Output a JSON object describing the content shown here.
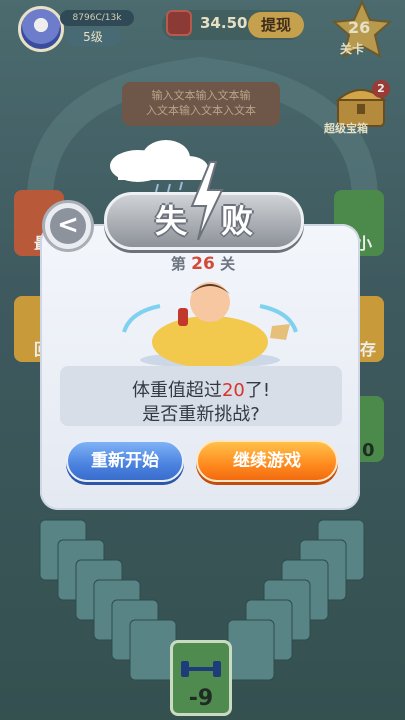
{
  "player": {
    "progress_text": "8796C/13k",
    "level": "5级"
  },
  "cash": {
    "value": "34.50",
    "withdraw_label": "提现"
  },
  "stage": {
    "number": "26",
    "label": "关卡"
  },
  "tutorial": {
    "line1": "输入文本输入文本输",
    "line2": "入文本输入文本入文本"
  },
  "treasure": {
    "label": "超级宝箱",
    "count": "2"
  },
  "side_labels": {
    "left_top": "最",
    "left_mid": "回",
    "right_top": "小",
    "right_mid": "存",
    "right_low": "0"
  },
  "modal": {
    "title": "失败",
    "stage_prefix": "第",
    "stage_num": "26",
    "stage_suffix": "关",
    "message_line1_prefix": "体重值超过",
    "message_line1_value": "20",
    "message_line1_suffix": "了!",
    "message_line2": "是否重新挑战?",
    "restart_label": "重新开始",
    "continue_label": "继续游戏",
    "back_glyph": "<"
  },
  "bottom_card": {
    "value": "-9"
  },
  "colors": {
    "restart_blue": "#4a82df",
    "continue_orange": "#ff8a1e",
    "highlight_red": "#d8342a"
  }
}
